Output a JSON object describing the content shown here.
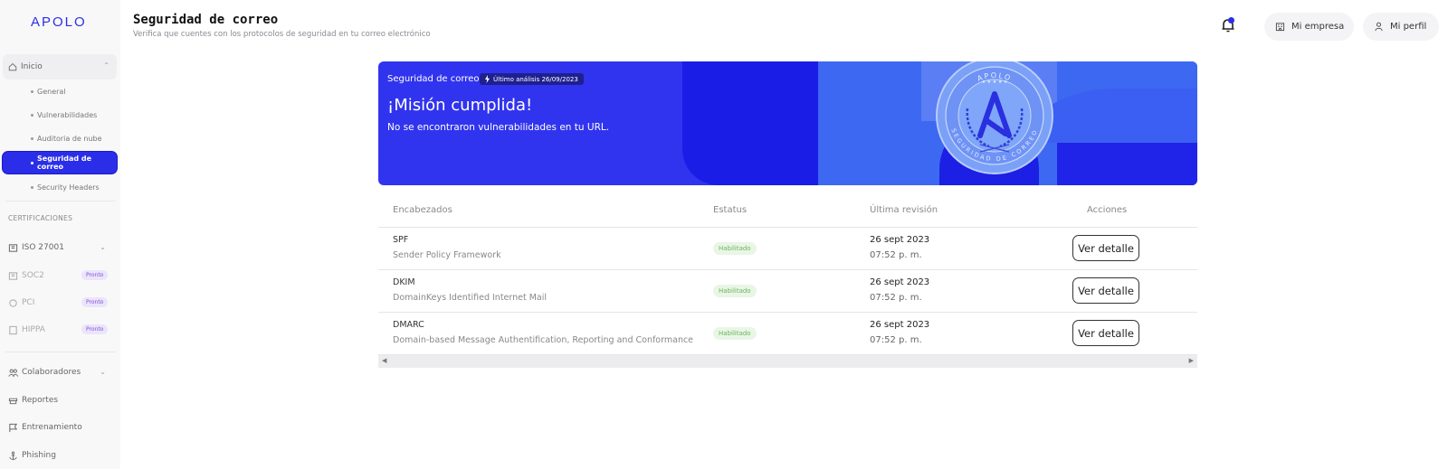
{
  "sidebar": {
    "logo": "APOLO",
    "group": {
      "label": "Inicio"
    },
    "sub_items": [
      {
        "label": "General"
      },
      {
        "label": "Vulnerabilidades"
      },
      {
        "label": "Auditoria de nube"
      },
      {
        "label": "Seguridad de correo"
      },
      {
        "label": "Security Headers"
      }
    ],
    "section_label": "CERTIFICACIONES",
    "certs": [
      {
        "label": "ISO 27001",
        "badge": ""
      },
      {
        "label": "SOC2",
        "badge": "Pronto"
      },
      {
        "label": "PCI",
        "badge": "Pronto"
      },
      {
        "label": "HIPPA",
        "badge": "Pronto"
      }
    ],
    "bottom_items": [
      {
        "label": "Colaboradores",
        "icon": "users-icon"
      },
      {
        "label": "Reportes",
        "icon": "report-icon"
      },
      {
        "label": "Entrenamiento",
        "icon": "flag-icon"
      },
      {
        "label": "Phishing",
        "icon": "anchor-icon"
      }
    ]
  },
  "header": {
    "title": "Seguridad de correo",
    "subtitle": "Verifica que cuentes con los protocolos de seguridad en tu correo electrónico",
    "company_label": "Mi empresa",
    "profile_label": "Mi perfil"
  },
  "banner": {
    "title": "Seguridad de correo",
    "tag": "Último análisis 26/09/2023",
    "heading": "¡Misión cumplida!",
    "message": "No se encontraron vulnerabilidades en tu URL.",
    "seal_text_top": "APOLO",
    "seal_text_bottom": "SEGURIDAD DE CORREO"
  },
  "table": {
    "headers": {
      "name": "Encabezados",
      "status": "Estatus",
      "last": "Última revisión",
      "actions": "Acciones"
    },
    "rows": [
      {
        "name": "SPF",
        "desc": "Sender Policy Framework",
        "status": "Habilitado",
        "date": "26 sept 2023",
        "time": "07:52 p. m.",
        "action": "Ver detalle"
      },
      {
        "name": "DKIM",
        "desc": "DomainKeys Identified Internet Mail",
        "status": "Habilitado",
        "date": "26 sept 2023",
        "time": "07:52 p. m.",
        "action": "Ver detalle"
      },
      {
        "name": "DMARC",
        "desc": "Domain-based Message Authentification, Reporting and Conformance",
        "status": "Habilitado",
        "date": "26 sept 2023",
        "time": "07:52 p. m.",
        "action": "Ver detalle"
      }
    ]
  },
  "colors": {
    "accent": "#2b2ee8",
    "banner": "#3134ee",
    "success": "#6bb45c"
  }
}
